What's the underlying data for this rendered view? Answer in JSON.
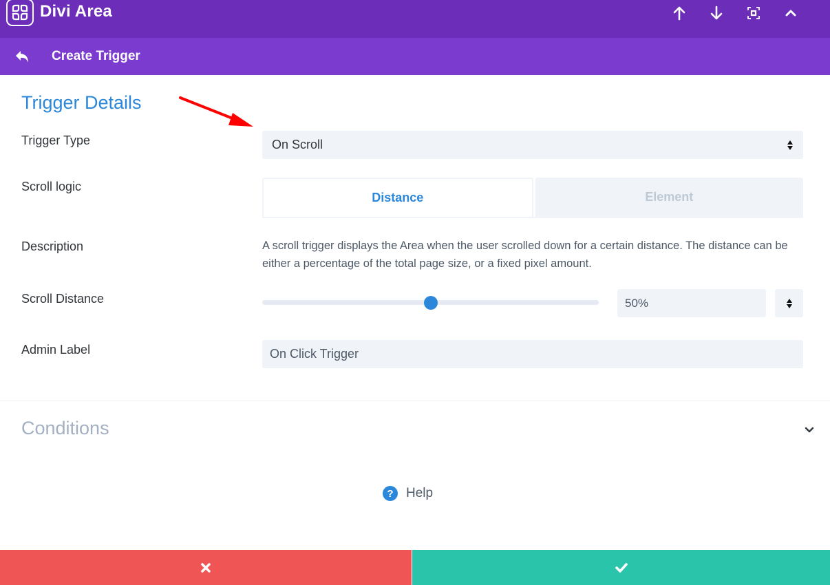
{
  "header": {
    "app_title": "Divi Area",
    "icons": [
      "logo-grid-icon",
      "arrow-up-icon",
      "arrow-down-icon",
      "focus-frame-icon",
      "chevron-up-icon"
    ]
  },
  "subheader": {
    "title": "Create Trigger",
    "back_icon": "reply-arrow-icon"
  },
  "trigger_details": {
    "section_title": "Trigger Details",
    "fields": {
      "trigger_type": {
        "label": "Trigger Type",
        "value": "On Scroll"
      },
      "scroll_logic": {
        "label": "Scroll logic",
        "tabs": [
          {
            "label": "Distance",
            "active": true
          },
          {
            "label": "Element",
            "active": false
          }
        ]
      },
      "description": {
        "label": "Description",
        "text": "A scroll trigger displays the Area when the user scrolled down for a certain distance. The distance can be either a percentage of the total page size, or a fixed pixel amount."
      },
      "scroll_distance": {
        "label": "Scroll Distance",
        "slider_percent": 50,
        "value": "50%"
      },
      "admin_label": {
        "label": "Admin Label",
        "value": "On Click Trigger"
      }
    }
  },
  "conditions": {
    "title": "Conditions",
    "expanded": false
  },
  "help": {
    "label": "Help",
    "icon": "?"
  },
  "footer": {
    "cancel_icon": "close-x-icon",
    "save_icon": "checkmark-icon"
  },
  "colors": {
    "header_bg": "#6c2eb9",
    "subheader_bg": "#7b3bcf",
    "accent_blue": "#2b87da",
    "cancel_red": "#ef5555",
    "save_teal": "#29c4a9",
    "input_bg": "#f0f3f8",
    "annotation_arrow": "#ff0000"
  }
}
